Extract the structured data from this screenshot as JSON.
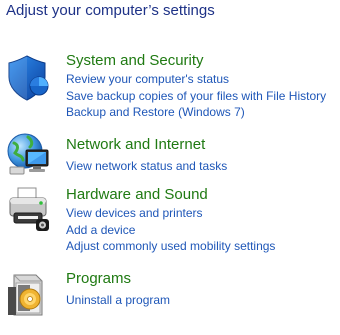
{
  "page": {
    "title": "Adjust your computer’s settings"
  },
  "categories": [
    {
      "title": "System and Security",
      "icon": "shield-icon",
      "links": [
        "Review your computer's status",
        "Save backup copies of your files with File History",
        "Backup and Restore (Windows 7)"
      ]
    },
    {
      "title": "Network and Internet",
      "icon": "network-globe-icon",
      "links": [
        "View network status and tasks"
      ]
    },
    {
      "title": "Hardware and Sound",
      "icon": "printer-icon",
      "links": [
        "View devices and printers",
        "Add a device",
        "Adjust commonly used mobility settings"
      ]
    },
    {
      "title": "Programs",
      "icon": "programs-box-icon",
      "links": [
        "Uninstall a program"
      ]
    }
  ],
  "colors": {
    "page_title": "#1e3287",
    "category_title": "#1f7a12",
    "link": "#1f57b8",
    "background": "#ffffff"
  }
}
